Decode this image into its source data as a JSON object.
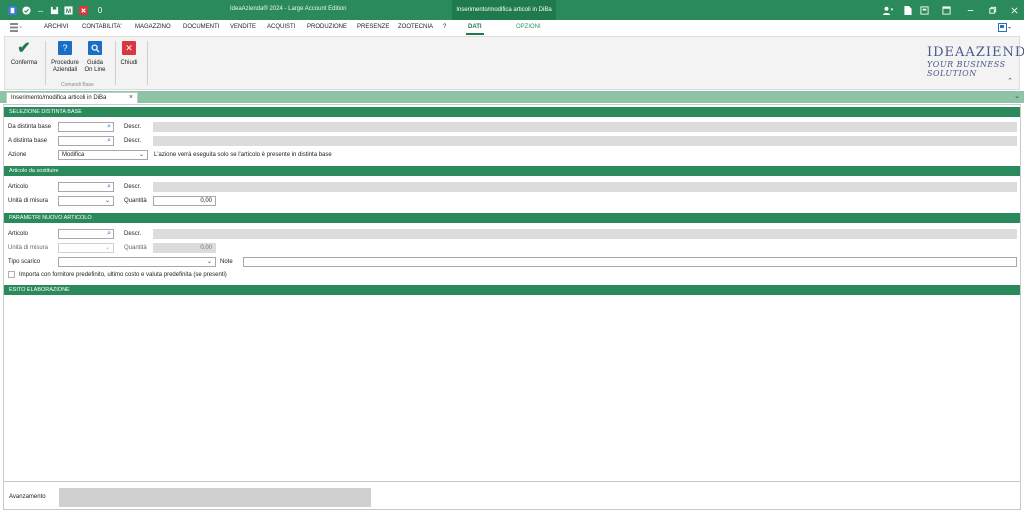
{
  "titlebar": {
    "app_title": "IdeaAzienda® 2024 - Large Account Edition",
    "context_tab": "Inserimento/modifica articoli in DiBa",
    "quick_access_counter": "0"
  },
  "menu": {
    "items": [
      "ARCHIVI",
      "CONTABILITA'",
      "MAGAZZINO",
      "DOCUMENTI",
      "VENDITE",
      "ACQUISTI",
      "PRODUZIONE",
      "PRESENZE",
      "ZOOTECNIA",
      "?"
    ],
    "active": "DATI",
    "options": "OPZIONI"
  },
  "ribbon": {
    "confirm": "Conferma",
    "procedures_l1": "Procedure",
    "procedures_l2": "Aziendali",
    "guide_l1": "Guida",
    "guide_l2": "On Line",
    "close": "Chiudi",
    "group_label": "Comandi Base",
    "logo_l1": "IDEAAZIENDA",
    "logo_l2": "YOUR BUSINESS SOLUTION"
  },
  "doc_tab": {
    "label": "Inserimento/modifica articoli in DiBa"
  },
  "sec1": {
    "title": "SELEZIONE DISTINTA BASE",
    "da_label": "Da distinta base",
    "a_label": "A distinta base",
    "descr_label": "Descr.",
    "azione_label": "Azione",
    "azione_value": "Modifica",
    "azione_note": "L'azione verrà eseguita solo se l'articolo è presente in distinta base"
  },
  "sec2": {
    "title": "Articolo da sostituire",
    "articolo_label": "Articolo",
    "descr_label": "Descr.",
    "um_label": "Unità di misura",
    "qty_label": "Quantità",
    "qty_value": "0,00"
  },
  "sec3": {
    "title": "PARAMETRI NUOVO ARTICOLO",
    "articolo_label": "Articolo",
    "descr_label": "Descr.",
    "um_label": "Unità di misura",
    "qty_label": "Quantità",
    "qty_value": "0,00",
    "tipo_label": "Tipo scarico",
    "note_label": "Note",
    "import_label": "Importa con fornitore predefinito, ultimo costo e valuta predefinita (se presenti)"
  },
  "sec4": {
    "title": "ESITO ELABORAZIONE"
  },
  "footer": {
    "avanzamento_label": "Avanzamento"
  }
}
